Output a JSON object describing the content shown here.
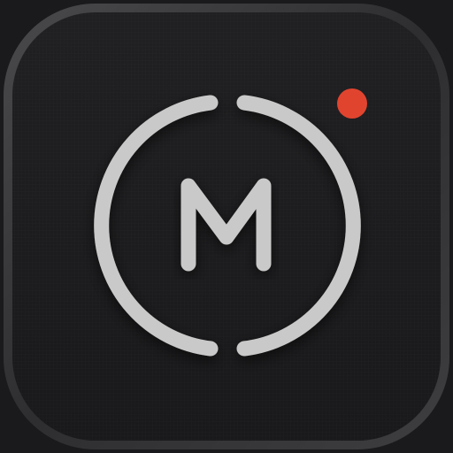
{
  "icon": {
    "monogram": "M",
    "record_indicator_color": "#e0442f",
    "ring_color": "#c9c9c9",
    "background_color": "#1f1f21",
    "bezel_color": "#3a3a3c"
  },
  "icons": {
    "app": "app-icon",
    "ring": "circle-ring-icon",
    "monogram": "monogram-m-icon",
    "record_dot": "record-dot-icon"
  }
}
